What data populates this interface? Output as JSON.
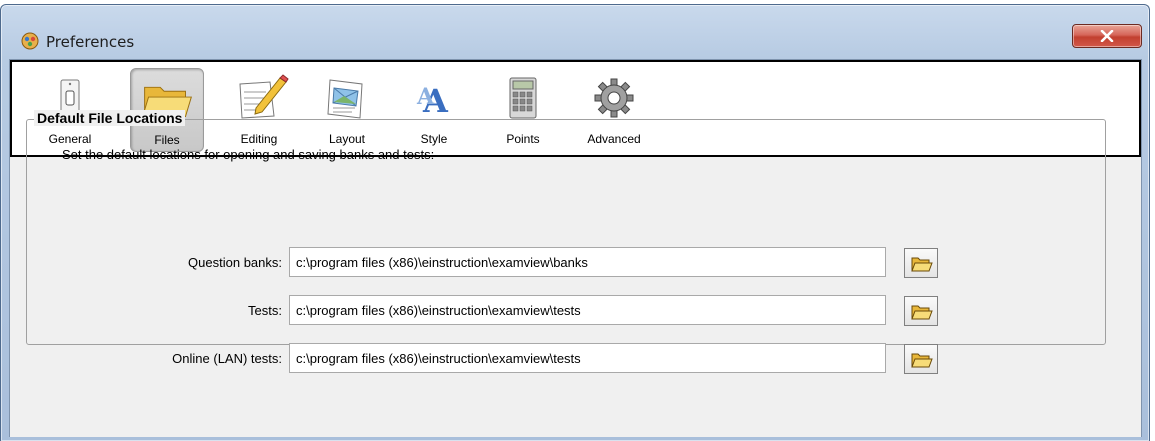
{
  "window": {
    "title": "Preferences",
    "close_icon": "close-icon",
    "colors": {
      "titlebar": "#b7cbe3",
      "close": "#c2402f",
      "client": "#f0f0f0"
    }
  },
  "toolbar": {
    "tabs": [
      {
        "label": "General",
        "icon": "light-switch-icon",
        "selected": false
      },
      {
        "label": "Files",
        "icon": "folder-icon",
        "selected": true
      },
      {
        "label": "Editing",
        "icon": "pencil-paper-icon",
        "selected": false
      },
      {
        "label": "Layout",
        "icon": "layout-page-icon",
        "selected": false
      },
      {
        "label": "Style",
        "icon": "font-style-icon",
        "selected": false
      },
      {
        "label": "Points",
        "icon": "calculator-icon",
        "selected": false
      },
      {
        "label": "Advanced",
        "icon": "gear-icon",
        "selected": false
      }
    ]
  },
  "files": {
    "group_title": "Default File Locations",
    "description": "Set the default locations for opening and saving banks and tests:",
    "rows": [
      {
        "label": "Question banks:",
        "value": "c:\\program files (x86)\\einstruction\\examview\\banks",
        "browse_icon": "open-folder-icon"
      },
      {
        "label": "Tests:",
        "value": "c:\\program files (x86)\\einstruction\\examview\\tests",
        "browse_icon": "open-folder-icon"
      },
      {
        "label": "Online (LAN) tests:",
        "value": "c:\\program files (x86)\\einstruction\\examview\\tests",
        "browse_icon": "open-folder-icon"
      }
    ]
  }
}
